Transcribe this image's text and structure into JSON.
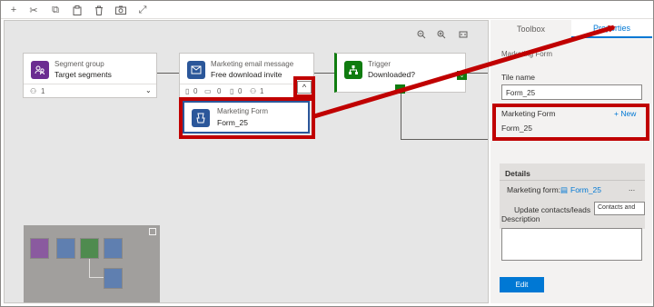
{
  "toolbar": {
    "buttons": [
      {
        "name": "add-icon",
        "glyph": "+"
      },
      {
        "name": "cut-icon",
        "glyph": "✂"
      },
      {
        "name": "copy-icon",
        "glyph": "⧉"
      },
      {
        "name": "paste-icon",
        "glyph": "📋"
      },
      {
        "name": "delete-icon",
        "glyph": "🗑"
      },
      {
        "name": "screenshot-icon",
        "glyph": "⌾"
      },
      {
        "name": "expand-icon",
        "glyph": "⤢"
      }
    ]
  },
  "canvas": {
    "zoom_out_glyph": "−",
    "zoom_in_glyph": "+",
    "fit_glyph": "⛶",
    "tiles": {
      "segment": {
        "type": "Segment group",
        "name": "Target segments",
        "count": "1",
        "color": "#6b2c91"
      },
      "email": {
        "type": "Marketing email message",
        "name": "Free download invite",
        "stats": [
          "0",
          "0",
          "0",
          "1"
        ],
        "color": "#2b579a"
      },
      "trigger": {
        "type": "Trigger",
        "name": "Downloaded?",
        "color": "#107c10"
      },
      "form": {
        "type": "Marketing Form",
        "name": "Form_25",
        "color": "#2b579a"
      }
    },
    "expander_glyph": "^",
    "chevron_glyph": "⌄"
  },
  "panel": {
    "tabs": {
      "toolbox": "Toolbox",
      "properties": "Properties"
    },
    "section_title": "Marketing Form",
    "tile_name_label": "Tile name",
    "tile_name_value": "Form_25",
    "form_label": "Marketing Form",
    "new_link": "+ New",
    "form_value": "Form_25",
    "details_title": "Details",
    "details_form_label": "Marketing form:",
    "details_form_value": "Form_25",
    "details_more": "...",
    "update_label": "Update contacts/leads",
    "update_value": "Contacts and",
    "description_label": "Description",
    "edit_button": "Edit"
  },
  "colors": {
    "highlight": "#c00000",
    "accent": "#0078d4"
  }
}
